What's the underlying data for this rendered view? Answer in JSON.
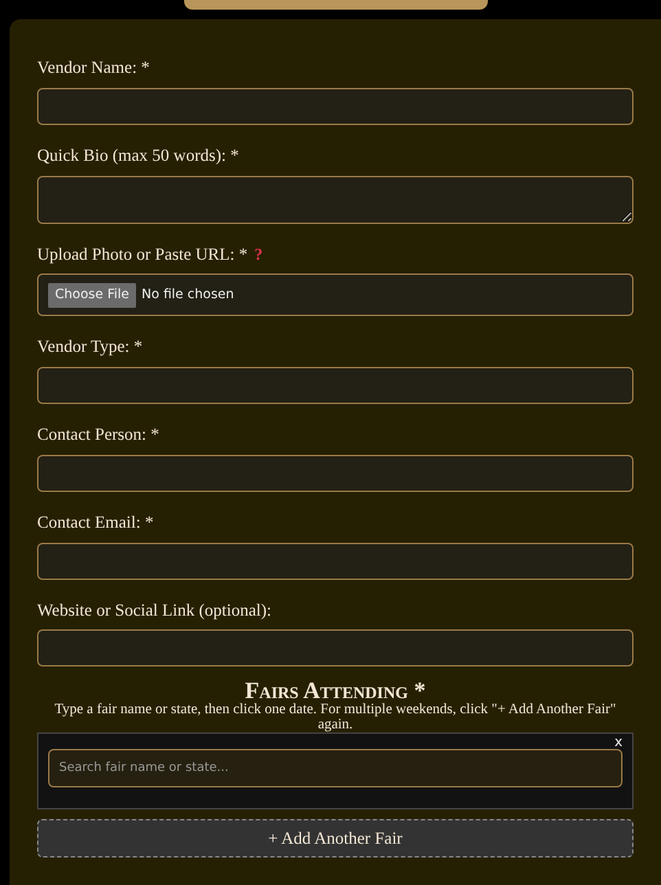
{
  "fields": [
    {
      "kind": "text",
      "label": "Vendor Name: *"
    },
    {
      "kind": "textarea",
      "label": "Quick Bio (max 50 words): *"
    },
    {
      "kind": "file",
      "label": "Upload Photo or Paste URL: *",
      "help": "?",
      "button": "Choose File",
      "status": "No file chosen"
    },
    {
      "kind": "text",
      "label": "Vendor Type: *"
    },
    {
      "kind": "text",
      "label": "Contact Person: *"
    },
    {
      "kind": "text",
      "label": "Contact Email: *"
    },
    {
      "kind": "text",
      "label": "Website or Social Link (optional):"
    }
  ],
  "fairs": {
    "heading": "Fairs Attending *",
    "hint": "Type a fair name or state, then click one date. For multiple weekends, click \"+ Add Another Fair\" again.",
    "entries": [
      {
        "close": "x",
        "placeholder": "Search fair name or state..."
      }
    ],
    "add_button": "+ Add Another Fair"
  }
}
